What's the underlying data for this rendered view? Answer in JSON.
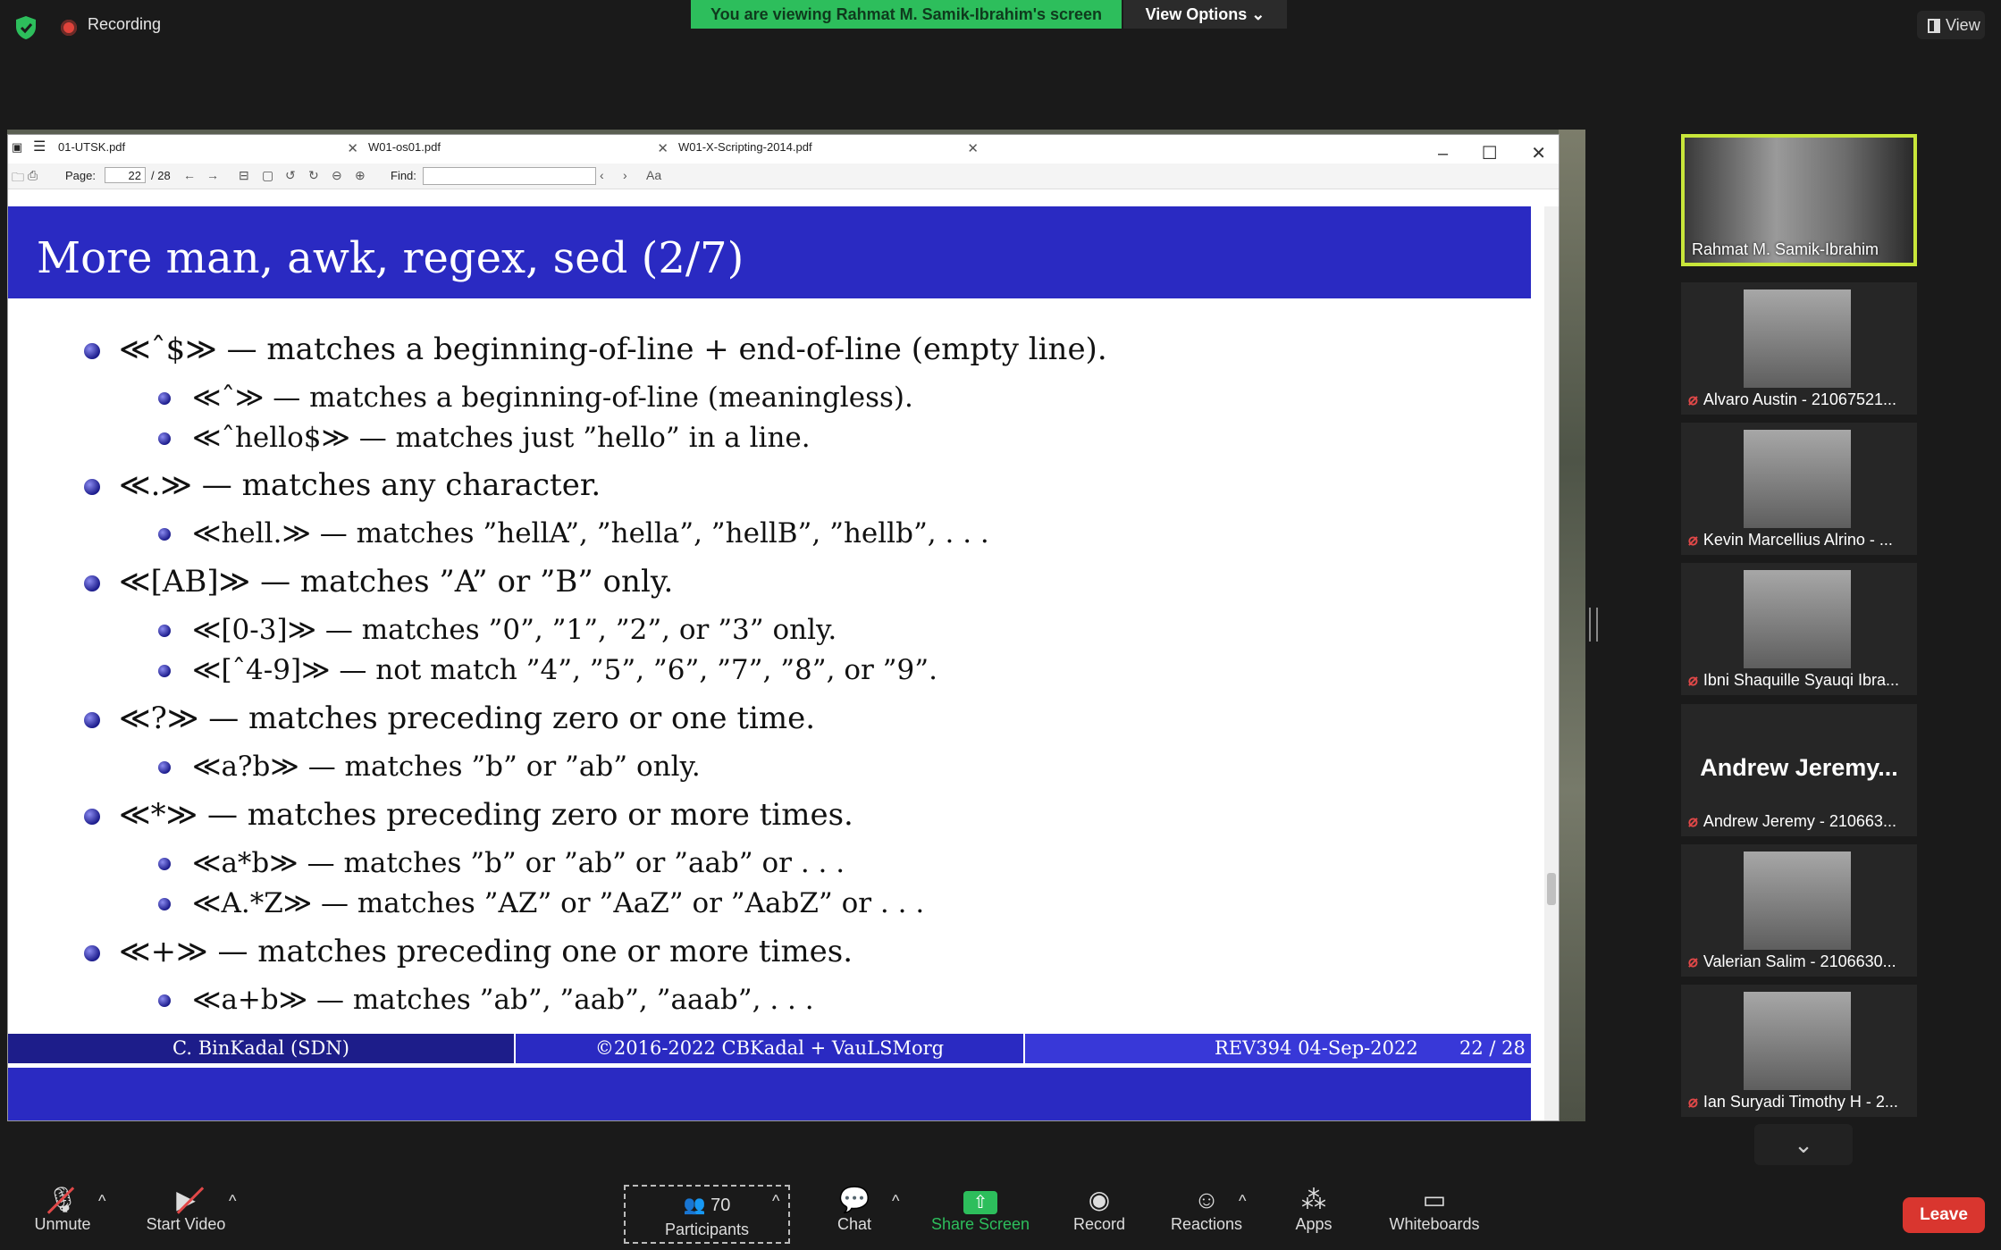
{
  "top": {
    "recording_label": "Recording",
    "viewing_banner": "You are viewing Rahmat M. Samik-Ibrahim's screen",
    "view_options": "View Options ⌄",
    "view_button": "View"
  },
  "viewer": {
    "tabs": [
      {
        "label": "01-UTSK.pdf"
      },
      {
        "label": "W01-os01.pdf"
      },
      {
        "label": "W01-X-Scripting-2014.pdf"
      }
    ],
    "toolbar": {
      "page_label": "Page:",
      "page_value": "22",
      "page_total": "/ 28",
      "find_label": "Find:"
    }
  },
  "slide": {
    "title": "More man, awk, regex, sed (2/7)",
    "lines": [
      {
        "level": 1,
        "text": "≪ˆ$≫ — matches a beginning-of-line + end-of-line (empty line)."
      },
      {
        "level": 2,
        "text": "≪ˆ≫ — matches a beginning-of-line (meaningless)."
      },
      {
        "level": 2,
        "text": "≪ˆhello$≫ — matches just ”hello” in a line."
      },
      {
        "level": 1,
        "text": "≪.≫ — matches any character."
      },
      {
        "level": 2,
        "text": "≪hell.≫ — matches ”hellA”, ”hella”, ”hellB”, ”hellb”, . . ."
      },
      {
        "level": 1,
        "text": "≪[AB]≫ — matches ”A” or ”B” only."
      },
      {
        "level": 2,
        "text": "≪[0-3]≫ — matches ”0”, ”1”, ”2”, or ”3” only."
      },
      {
        "level": 2,
        "text": "≪[ˆ4-9]≫ — not match ”4”, ”5”, ”6”, ”7”, ”8”, or ”9”."
      },
      {
        "level": 1,
        "text": "≪?≫ — matches preceding zero or one time."
      },
      {
        "level": 2,
        "text": "≪a?b≫ — matches ”b” or ”ab” only."
      },
      {
        "level": 1,
        "text": "≪*≫ — matches preceding zero or more times."
      },
      {
        "level": 2,
        "text": "≪a*b≫ — matches ”b” or ”ab” or ”aab” or . . ."
      },
      {
        "level": 2,
        "text": "≪A.*Z≫ — matches ”AZ” or ”AaZ” or ”AabZ” or . . ."
      },
      {
        "level": 1,
        "text": "≪+≫ — matches preceding one or more times."
      },
      {
        "level": 2,
        "text": "≪a+b≫ — matches ”ab”, ”aab”, ”aaab”, . . ."
      }
    ],
    "footer": {
      "left": "C. BinKadal  (SDN)",
      "middle": "©2016-2022 CBKadal + VauLSMorg",
      "revision": "REV394 04-Sep-2022",
      "page": "22 / 28"
    }
  },
  "participants_panel": {
    "host": "Rahmat M. Samik-Ibrahim",
    "tiles": [
      {
        "name": "Alvaro Austin - 21067521..."
      },
      {
        "name": "Kevin Marcellius Alrino - ..."
      },
      {
        "name": "Ibni Shaquille Syauqi Ibra..."
      },
      {
        "name": "Andrew Jeremy - 210663...",
        "big_name": "Andrew  Jeremy..."
      },
      {
        "name": "Valerian Salim - 2106630..."
      },
      {
        "name": "Ian Suryadi Timothy H - 2..."
      }
    ]
  },
  "bottom": {
    "unmute": "Unmute",
    "start_video": "Start Video",
    "participants_count": "70",
    "participants": "Participants",
    "chat": "Chat",
    "share_screen": "Share Screen",
    "record": "Record",
    "reactions": "Reactions",
    "apps": "Apps",
    "whiteboards": "Whiteboards",
    "leave": "Leave"
  },
  "colors": {
    "slide_blue": "#2a2ac2",
    "banner_green": "#2dbe5c",
    "leave_red": "#d9362f",
    "host_border": "#c8e63a"
  }
}
